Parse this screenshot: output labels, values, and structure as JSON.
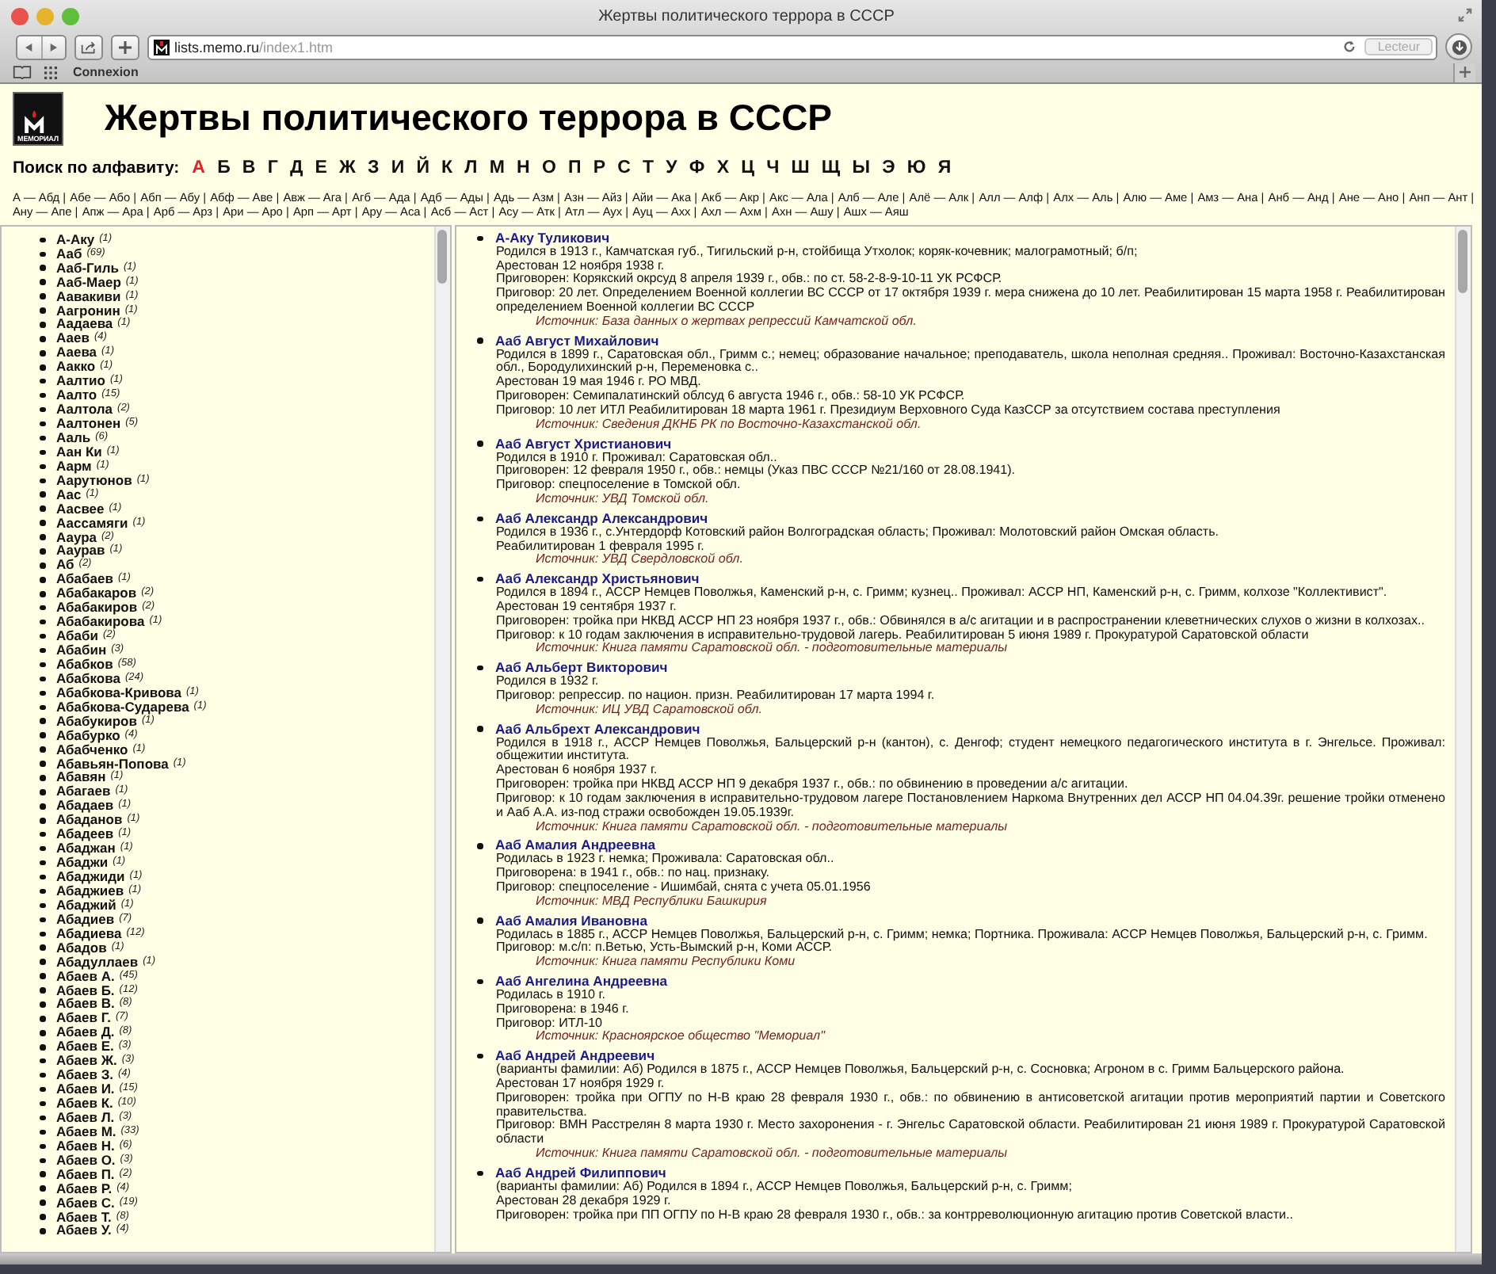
{
  "window": {
    "title": "Жертвы политического террора в СССР",
    "url_host": "lists.memo.ru",
    "url_path": "/index1.htm",
    "reader_button": "Lecteur",
    "bookmark": "Connexion"
  },
  "page": {
    "logo_text": "МЕМОРИАЛ",
    "heading": "Жертвы политического террора в СССР",
    "alphabet_label": "Поиск по алфавиту:",
    "letters": [
      {
        "label": "А",
        "selected": true
      },
      {
        "label": "Б",
        "selected": false
      },
      {
        "label": "В",
        "selected": false
      },
      {
        "label": "Г",
        "selected": false
      },
      {
        "label": "Д",
        "selected": false
      },
      {
        "label": "Е",
        "selected": false
      },
      {
        "label": "Ж",
        "selected": false
      },
      {
        "label": "З",
        "selected": false
      },
      {
        "label": "И",
        "selected": false
      },
      {
        "label": "Й",
        "selected": false
      },
      {
        "label": "К",
        "selected": false
      },
      {
        "label": "Л",
        "selected": false
      },
      {
        "label": "М",
        "selected": false
      },
      {
        "label": "Н",
        "selected": false
      },
      {
        "label": "О",
        "selected": false
      },
      {
        "label": "П",
        "selected": false
      },
      {
        "label": "Р",
        "selected": false
      },
      {
        "label": "С",
        "selected": false
      },
      {
        "label": "Т",
        "selected": false
      },
      {
        "label": "У",
        "selected": false
      },
      {
        "label": "Ф",
        "selected": false
      },
      {
        "label": "Х",
        "selected": false
      },
      {
        "label": "Ц",
        "selected": false
      },
      {
        "label": "Ч",
        "selected": false
      },
      {
        "label": "Ш",
        "selected": false
      },
      {
        "label": "Щ",
        "selected": false
      },
      {
        "label": "Ы",
        "selected": false
      },
      {
        "label": "Э",
        "selected": false
      },
      {
        "label": "Ю",
        "selected": false
      },
      {
        "label": "Я",
        "selected": false
      }
    ],
    "ranges": [
      "А — Абд |",
      "Абе — Або |",
      "Абп — Абу |",
      "Абф — Аве |",
      "Авж — Ага |",
      "Агб — Ада |",
      "Адб — Ады |",
      "Адь — Азм |",
      "Азн — Айз |",
      "Айи — Ака |",
      "Акб — Акр |",
      "Акс — Ала |",
      "Алб — Але |",
      "Алё — Алк |",
      "Алл — Алф |",
      "Алх — Аль |",
      "Алю — Аме |",
      "Амз — Ана |",
      "Анб — Анд |",
      "Ане — Ано |",
      "Анп — Ант |",
      "Ану — Апе |",
      "Апж — Ара |",
      "Арб — Арз |",
      "Ари — Аро |",
      "Арп — Арт |",
      "Ару — Аса |",
      "Асб — Аст |",
      "Асу — Атк |",
      "Атл — Аух |",
      "Ауц — Ахх |",
      "Ахл — Ахм |",
      "Ахн — Ашу |",
      "Ашх — Аяш"
    ]
  },
  "surnames": [
    {
      "name": "А-Аку",
      "count": "(1)"
    },
    {
      "name": "Ааб",
      "count": "(69)"
    },
    {
      "name": "Ааб-Гиль",
      "count": "(1)"
    },
    {
      "name": "Ааб-Маер",
      "count": "(1)"
    },
    {
      "name": "Аавакиви",
      "count": "(1)"
    },
    {
      "name": "Аагронин",
      "count": "(1)"
    },
    {
      "name": "Аадаева",
      "count": "(1)"
    },
    {
      "name": "Ааев",
      "count": "(4)"
    },
    {
      "name": "Ааева",
      "count": "(1)"
    },
    {
      "name": "Аакко",
      "count": "(1)"
    },
    {
      "name": "Аалтио",
      "count": "(1)"
    },
    {
      "name": "Аалто",
      "count": "(15)"
    },
    {
      "name": "Аалтола",
      "count": "(2)"
    },
    {
      "name": "Аалтонен",
      "count": "(5)"
    },
    {
      "name": "Ааль",
      "count": "(6)"
    },
    {
      "name": "Аан Ки",
      "count": "(1)"
    },
    {
      "name": "Аарм",
      "count": "(1)"
    },
    {
      "name": "Аарутюнов",
      "count": "(1)"
    },
    {
      "name": "Аас",
      "count": "(1)"
    },
    {
      "name": "Аасвее",
      "count": "(1)"
    },
    {
      "name": "Аассамяги",
      "count": "(1)"
    },
    {
      "name": "Ааура",
      "count": "(2)"
    },
    {
      "name": "Ааурав",
      "count": "(1)"
    },
    {
      "name": "Аб",
      "count": "(2)"
    },
    {
      "name": "Абабаев",
      "count": "(1)"
    },
    {
      "name": "Абабакаров",
      "count": "(2)"
    },
    {
      "name": "Абабакиров",
      "count": "(2)"
    },
    {
      "name": "Абабакирова",
      "count": "(1)"
    },
    {
      "name": "Абаби",
      "count": "(2)"
    },
    {
      "name": "Абабин",
      "count": "(3)"
    },
    {
      "name": "Абабков",
      "count": "(58)"
    },
    {
      "name": "Абабкова",
      "count": "(24)"
    },
    {
      "name": "Абабкова-Кривова",
      "count": "(1)"
    },
    {
      "name": "Абабкова-Сударева",
      "count": "(1)"
    },
    {
      "name": "Абабукиров",
      "count": "(1)"
    },
    {
      "name": "Абабурко",
      "count": "(4)"
    },
    {
      "name": "Абабченко",
      "count": "(1)"
    },
    {
      "name": "Абавьян-Попова",
      "count": "(1)"
    },
    {
      "name": "Абавян",
      "count": "(1)"
    },
    {
      "name": "Абагаев",
      "count": "(1)"
    },
    {
      "name": "Абадаев",
      "count": "(1)"
    },
    {
      "name": "Абаданов",
      "count": "(1)"
    },
    {
      "name": "Абадеев",
      "count": "(1)"
    },
    {
      "name": "Абаджан",
      "count": "(1)"
    },
    {
      "name": "Абаджи",
      "count": "(1)"
    },
    {
      "name": "Абаджиди",
      "count": "(1)"
    },
    {
      "name": "Абаджиев",
      "count": "(1)"
    },
    {
      "name": "Абаджий",
      "count": "(1)"
    },
    {
      "name": "Абадиев",
      "count": "(7)"
    },
    {
      "name": "Абадиева",
      "count": "(12)"
    },
    {
      "name": "Абадов",
      "count": "(1)"
    },
    {
      "name": "Абадуллаев",
      "count": "(1)"
    },
    {
      "name": "Абаев А.",
      "count": "(45)"
    },
    {
      "name": "Абаев Б.",
      "count": "(12)"
    },
    {
      "name": "Абаев В.",
      "count": "(8)"
    },
    {
      "name": "Абаев Г.",
      "count": "(7)"
    },
    {
      "name": "Абаев Д.",
      "count": "(8)"
    },
    {
      "name": "Абаев Е.",
      "count": "(3)"
    },
    {
      "name": "Абаев Ж.",
      "count": "(3)"
    },
    {
      "name": "Абаев З.",
      "count": "(4)"
    },
    {
      "name": "Абаев И.",
      "count": "(15)"
    },
    {
      "name": "Абаев К.",
      "count": "(10)"
    },
    {
      "name": "Абаев Л.",
      "count": "(3)"
    },
    {
      "name": "Абаев М.",
      "count": "(33)"
    },
    {
      "name": "Абаев Н.",
      "count": "(6)"
    },
    {
      "name": "Абаев О.",
      "count": "(3)"
    },
    {
      "name": "Абаев П.",
      "count": "(2)"
    },
    {
      "name": "Абаев Р.",
      "count": "(4)"
    },
    {
      "name": "Абаев С.",
      "count": "(19)"
    },
    {
      "name": "Абаев Т.",
      "count": "(8)"
    },
    {
      "name": "Абаев У.",
      "count": "(4)"
    }
  ],
  "records": [
    {
      "name": "А-Аку Туликович",
      "lines": [
        "Родился в 1913 г., Камчатская губ., Тигильский р-н, стойбища Утхолок; коряк-кочевник; малограмотный; б/п;",
        "Арестован 12 ноября 1938 г.",
        "Приговорен: Корякский окрсуд 8 апреля 1939 г., обв.: по ст. 58-2-8-9-10-11 УК РСФСР.",
        "Приговор: 20 лет. Определением Военной коллегии ВС СССР от 17 октября 1939 г. мера снижена до 10 лет. Реабилитирован 15 марта 1958 г. Реабилитирован определением Военной коллегии ВС СССР"
      ],
      "source": "Источник: База данных о жертвах репрессий Камчатской обл."
    },
    {
      "name": "Ааб Август Михайлович",
      "lines": [
        "Родился в 1899 г., Саратовская обл., Гримм с.; немец; образование начальное; преподаватель, школа неполная средняя.. Проживал: Восточно-Казахстанская обл., Бородулихинский р-н, Переменовка с..",
        "Арестован 19 мая 1946 г. РО МВД.",
        "Приговорен: Семипалатинский облсуд 6 августа 1946 г., обв.: 58-10 УК РСФСР.",
        "Приговор: 10 лет ИТЛ Реабилитирован 18 марта 1961 г. Президиум Верховного Суда КазССР за отсутствием состава преступления"
      ],
      "source": "Источник: Сведения ДКНБ РК по Восточно-Казахстанской обл."
    },
    {
      "name": "Ааб Август Христианович",
      "lines": [
        "Родился в 1910 г. Проживал: Саратовская обл..",
        "Приговорен: 12 февраля 1950 г., обв.: немцы (Указ ПВС СССР №21/160 от 28.08.1941).",
        "Приговор: спецпоселение в Томской обл."
      ],
      "source": "Источник: УВД Томской обл."
    },
    {
      "name": "Ааб Александр Александрович",
      "lines": [
        "Родился в 1936 г., с.Унтердорф Котовский район Волгоградская область; Проживал: Молотовский район Омская область.",
        "Реабилитирован 1 февраля 1995 г."
      ],
      "source": "Источник: УВД Свердловской обл."
    },
    {
      "name": "Ааб Александр Христьянович",
      "lines": [
        "Родился в 1894 г., АССР Немцев Поволжья, Каменский р-н, с. Гримм; кузнец.. Проживал: АССР НП, Каменский р-н, с. Гримм, колхозе \"Коллективист\".",
        "Арестован 19 сентября 1937 г.",
        "Приговорен: тройка при НКВД АССР НП 23 ноября 1937 г., обв.: Обвинялся в а/с агитации и в распространении клеветнических слухов о жизни в колхозах..",
        "Приговор: к 10 годам заключения в исправительно-трудовой лагерь. Реабилитирован 5 июня 1989 г. Прокуратурой Саратовской области"
      ],
      "source": "Источник: Книга памяти Саратовской обл. - подготовительные материалы"
    },
    {
      "name": "Ааб Альберт Викторович",
      "lines": [
        "Родился в 1932 г.",
        "Приговор: репрессир. по национ. призн. Реабилитирован 17 марта 1994 г."
      ],
      "source": "Источник: ИЦ УВД Саратовской обл."
    },
    {
      "name": "Ааб Альбрехт Александрович",
      "lines": [
        "Родился в 1918 г., АССР Немцев Поволжья, Бальцерский р-н (кантон), с. Денгоф; студент немецкого педагогического института в г. Энгельсе. Проживал: общежитии института.",
        "Арестован 6 ноября 1937 г.",
        "Приговорен: тройка при НКВД АССР НП 9 декабря 1937 г., обв.: по обвинению в проведении а/с агитации.",
        "Приговор: к 10 годам заключения в исправительно-трудовом лагере Постановлением Наркома Внутренних дел АССР НП 04.04.39г. решение тройки отменено и Ааб А.А. из-под стражи освобожден 19.05.1939г."
      ],
      "source": "Источник: Книга памяти Саратовской обл. - подготовительные материалы"
    },
    {
      "name": "Ааб Амалия Андреевна",
      "lines": [
        "Родилась в 1923 г. немка; Проживала: Саратовская обл..",
        "Приговорена: в 1941 г., обв.: по нац. признаку.",
        "Приговор: спецпоселение - Ишимбай, снята с учета 05.01.1956"
      ],
      "source": "Источник: МВД Республики Башкирия"
    },
    {
      "name": "Ааб Амалия Ивановна",
      "lines": [
        "Родилась в 1885 г., АССР Немцев Поволжья, Бальцерский р-н, с. Гримм; немка; Портника. Проживала: АССР Немцев Поволжья, Бальцерский р-н, с. Гримм.",
        "Приговор: м.с/п: п.Ветью, Усть-Вымский р-н, Коми АССР."
      ],
      "source": "Источник: Книга памяти Республики Коми"
    },
    {
      "name": "Ааб Ангелина Андреевна",
      "lines": [
        "Родилась в 1910 г.",
        "Приговорена: в 1946 г.",
        "Приговор: ИТЛ-10"
      ],
      "source": "Источник: Красноярское общество \"Мемориал\""
    },
    {
      "name": "Ааб Андрей Андреевич",
      "lines": [
        "(варианты фамилии: Аб) Родился в 1875 г., АССР Немцев Поволжья, Бальцерский р-н, с. Сосновка; Агроном в с. Гримм Бальцерского района.",
        "Арестован 17 ноября 1929 г.",
        "Приговорен: тройка при ОГПУ по Н-В краю 28 февраля 1930 г., обв.: по обвинению в антисоветской агитации против мероприятий партии и Советского правительства.",
        "Приговор: ВМН Расстрелян 8 марта 1930 г. Место захоронения - г. Энгельс Саратовской области. Реабилитирован 21 июня 1989 г. Прокуратурой Саратовской области"
      ],
      "source": "Источник: Книга памяти Саратовской обл. - подготовительные материалы"
    },
    {
      "name": "Ааб Андрей Филиппович",
      "lines": [
        "(варианты фамилии: Аб) Родился в 1894 г., АССР Немцев Поволжья, Бальцерский р-н, с. Гримм;",
        "Арестован 28 декабря 1929 г.",
        "Приговорен: тройка при ПП ОГПУ по Н-В краю 28 февраля 1930 г., обв.: за контрреволюционную агитацию против Советской власти.."
      ]
    }
  ]
}
